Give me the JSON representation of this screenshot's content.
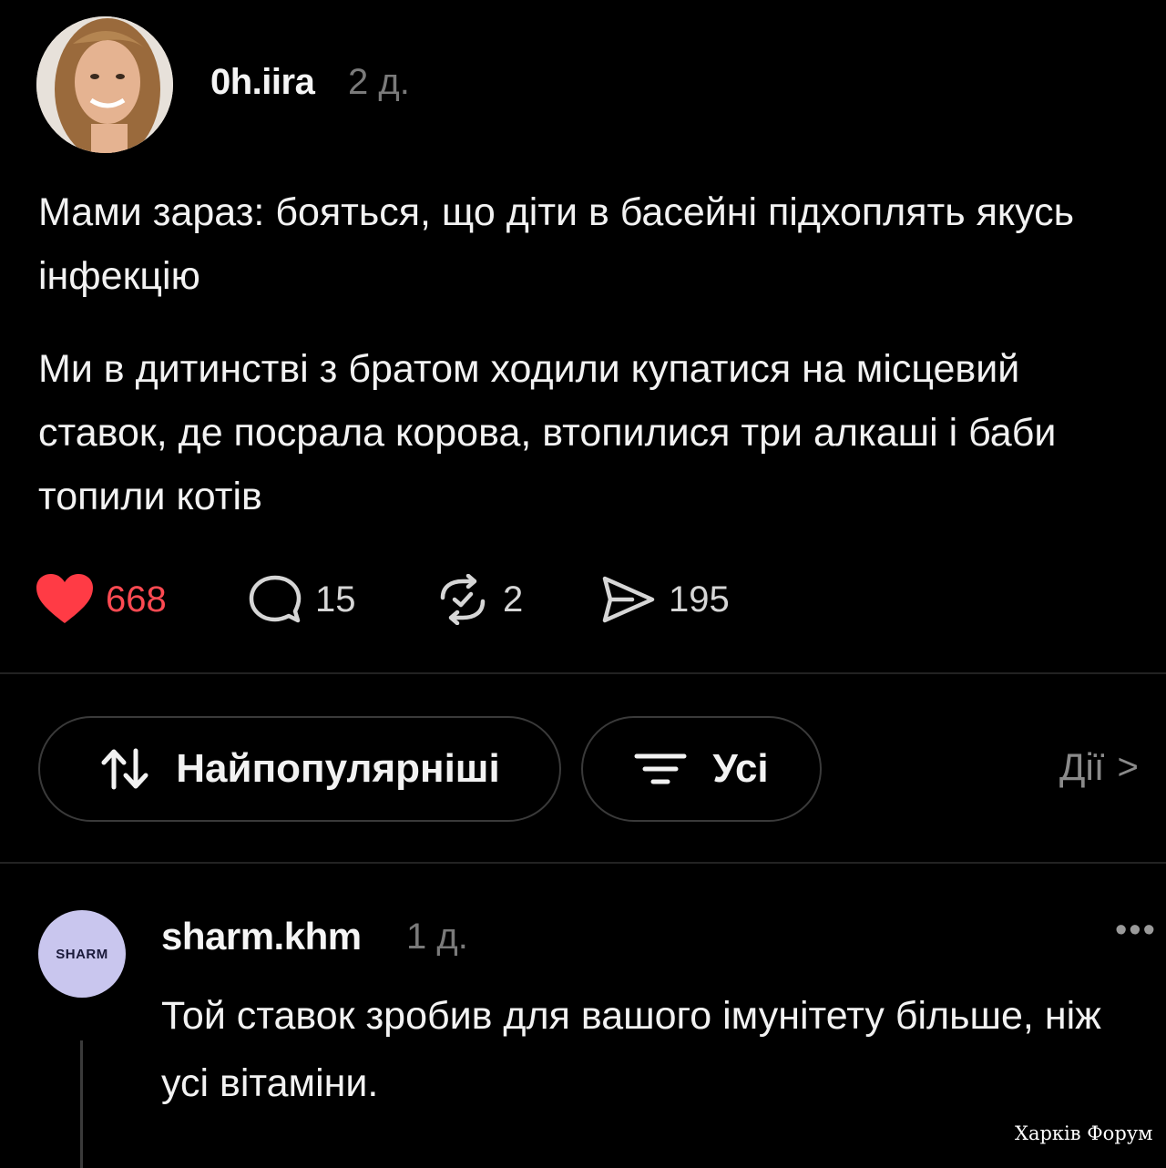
{
  "post": {
    "author": "0h.iira",
    "time": "2 д.",
    "paragraphs": [
      "Мами зараз: бояться, що діти в басейні підхоплять якусь інфекцію",
      "Ми в дитинстві з братом ходили купатися на місцевий ставок, де посрала корова, втопилися три алкаші і баби топили котів"
    ],
    "likes": "668",
    "comments": "15",
    "reposts": "2",
    "shares": "195"
  },
  "filters": {
    "sort_label": "Найпопулярніші",
    "filter_label": "Усі",
    "actions_label": "Дії",
    "actions_chevron": ">"
  },
  "comment": {
    "avatar_text": "SHARM",
    "author": "sharm.khm",
    "time": "1 д.",
    "more": "•••",
    "text": "Той ставок зробив для вашого імунітету більше, ніж усі вітаміни."
  },
  "watermark": "Харків Форум",
  "colors": {
    "background": "#000000",
    "like_red": "#ff3b45",
    "muted": "#7a7a7a",
    "avatar_bg": "#c9c6ee"
  },
  "icons": {
    "like": "heart-icon",
    "comment": "comment-bubble-icon",
    "repost": "repost-icon",
    "share": "send-icon",
    "sort": "sort-arrows-icon",
    "filter": "filter-lines-icon"
  }
}
